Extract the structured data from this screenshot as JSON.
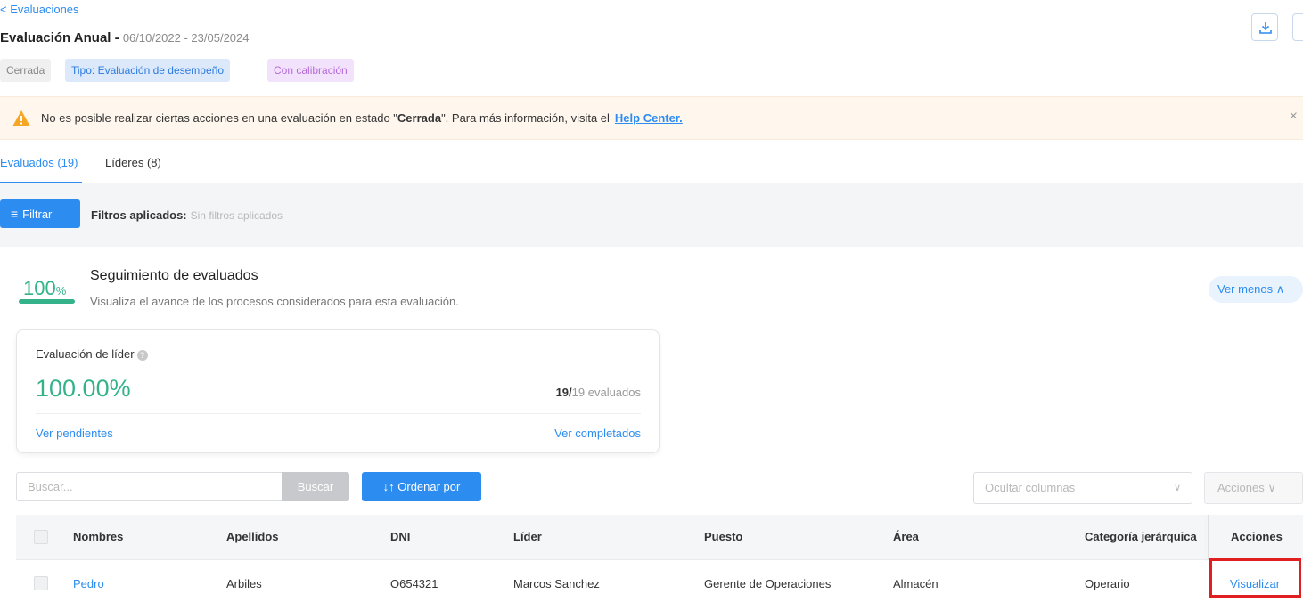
{
  "header": {
    "back_label": "< Evaluaciones",
    "title": "Evaluación Anual -",
    "date_range": "06/10/2022 - 23/05/2024",
    "tags": {
      "status": "Cerrada",
      "type": "Tipo: Evaluación de desempeño",
      "calibration": "Con calibración"
    }
  },
  "alert": {
    "message_before": "No es posible realizar ciertas acciones en una evaluación en estado \"",
    "message_bold": "Cerrada",
    "message_after": "\". Para más información, visita el",
    "link": "Help Center.",
    "close": "×"
  },
  "tabs": {
    "evaluados": "Evaluados (19)",
    "lideres": "Líderes (8)"
  },
  "filters": {
    "button": "Filtrar",
    "label": "Filtros aplicados:",
    "value": "Sin filtros aplicados"
  },
  "tracking": {
    "percent": "100",
    "percent_sign": "%",
    "progress": 1.0,
    "title": "Seguimiento de evaluados",
    "subtitle": "Visualiza el avance de los procesos considerados para esta evaluación.",
    "toggle": "Ver menos ∧"
  },
  "card": {
    "title": "Evaluación de líder",
    "help": "?",
    "percent": "100.00%",
    "count_done": "19/",
    "count_rest": "19 evaluados",
    "pending_link": "Ver pendientes",
    "completed_link": "Ver completados"
  },
  "toolbar": {
    "search_placeholder": "Buscar...",
    "search_button": "Buscar",
    "sort_button": "↓↑ Ordenar por",
    "hide_columns": "Ocultar columnas",
    "hide_columns_chevron": "∨",
    "actions": "Acciones ∨"
  },
  "table": {
    "headers": [
      "Nombres",
      "Apellidos",
      "DNI",
      "Líder",
      "Puesto",
      "Área",
      "Categoría jerárquica",
      "Acciones"
    ],
    "rows": [
      {
        "nombres": "Pedro",
        "apellidos": "Arbiles",
        "dni": "O654321",
        "lider": "Marcos Sanchez",
        "puesto": "Gerente de Operaciones",
        "area": "Almacén",
        "categoria": "Operario",
        "accion": "Visualizar"
      }
    ]
  },
  "colors": {
    "accent": "#2d8cf0",
    "success": "#34b38a",
    "warning": "#f5a623",
    "highlight": "#e02020"
  }
}
